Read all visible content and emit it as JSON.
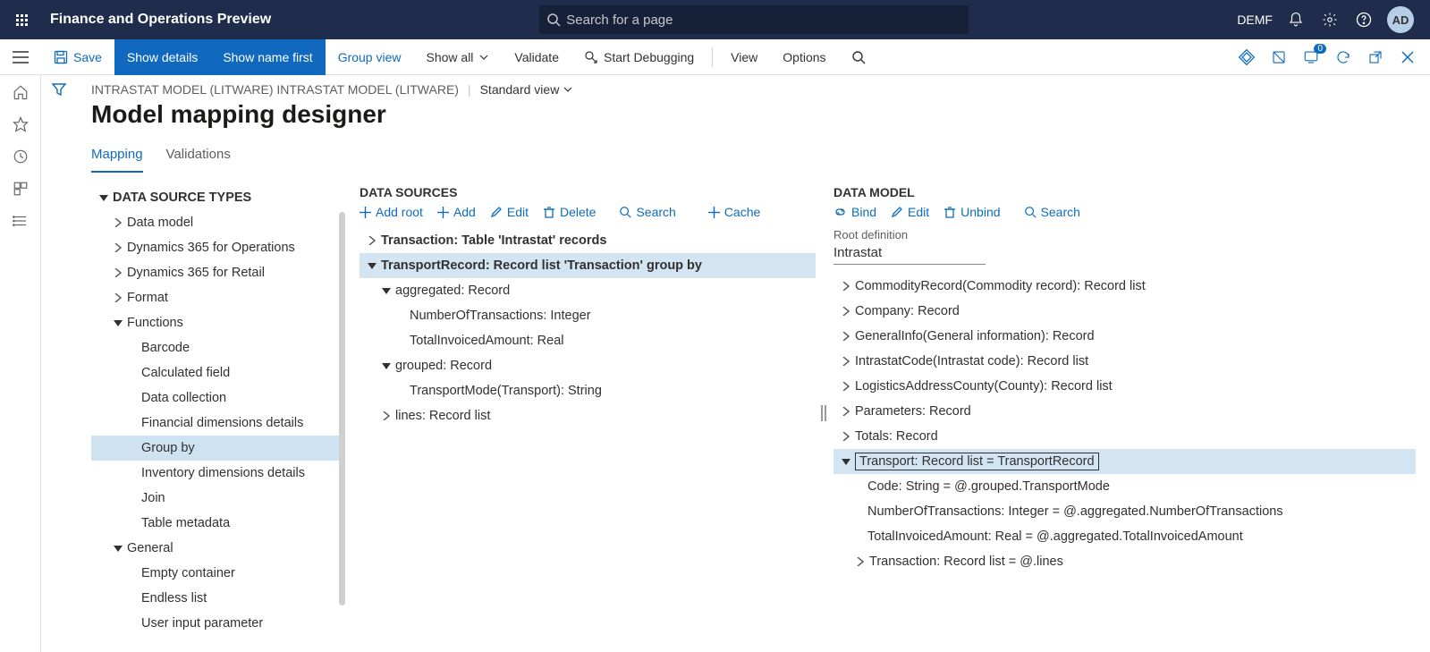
{
  "top": {
    "app_title": "Finance and Operations Preview",
    "search_placeholder": "Search for a page",
    "company": "DEMF",
    "avatar": "AD"
  },
  "actions": {
    "save": "Save",
    "show_details": "Show details",
    "show_name_first": "Show name first",
    "group_view": "Group view",
    "show_all": "Show all",
    "validate": "Validate",
    "start_debugging": "Start Debugging",
    "view": "View",
    "options": "Options",
    "badge": "0"
  },
  "header": {
    "breadcrumb": "INTRASTAT MODEL (LITWARE) INTRASTAT MODEL (LITWARE)",
    "view": "Standard view",
    "title": "Model mapping designer"
  },
  "tabs": {
    "mapping": "Mapping",
    "validations": "Validations"
  },
  "dstypes": {
    "header": "DATA SOURCE TYPES",
    "items": [
      "Data model",
      "Dynamics 365 for Operations",
      "Dynamics 365 for Retail",
      "Format",
      "Functions",
      "Barcode",
      "Calculated field",
      "Data collection",
      "Financial dimensions details",
      "Group by",
      "Inventory dimensions details",
      "Join",
      "Table metadata",
      "General",
      "Empty container",
      "Endless list",
      "User input parameter"
    ]
  },
  "ds": {
    "header": "DATA SOURCES",
    "toolbar": {
      "add_root": "Add root",
      "add": "Add",
      "edit": "Edit",
      "delete": "Delete",
      "search": "Search",
      "cache": "Cache"
    },
    "tree": {
      "r0": "Transaction: Table 'Intrastat' records",
      "r1": "TransportRecord: Record list 'Transaction' group by",
      "r2": "aggregated: Record",
      "r3": "NumberOfTransactions: Integer",
      "r4": "TotalInvoicedAmount: Real",
      "r5": "grouped: Record",
      "r6": "TransportMode(Transport): String",
      "r7": "lines: Record list"
    }
  },
  "dm": {
    "header": "DATA MODEL",
    "toolbar": {
      "bind": "Bind",
      "edit": "Edit",
      "unbind": "Unbind",
      "search": "Search"
    },
    "root_label": "Root definition",
    "root_value": "Intrastat",
    "tree": {
      "r0": "CommodityRecord(Commodity record): Record list",
      "r1": "Company: Record",
      "r2": "GeneralInfo(General information): Record",
      "r3": "IntrastatCode(Intrastat code): Record list",
      "r4": "LogisticsAddressCounty(County): Record list",
      "r5": "Parameters: Record",
      "r6": "Totals: Record",
      "r7": "Transport: Record list = TransportRecord",
      "r8": "Code: String = @.grouped.TransportMode",
      "r9": "NumberOfTransactions: Integer = @.aggregated.NumberOfTransactions",
      "r10": "TotalInvoicedAmount: Real = @.aggregated.TotalInvoicedAmount",
      "r11": "Transaction: Record list = @.lines"
    }
  }
}
